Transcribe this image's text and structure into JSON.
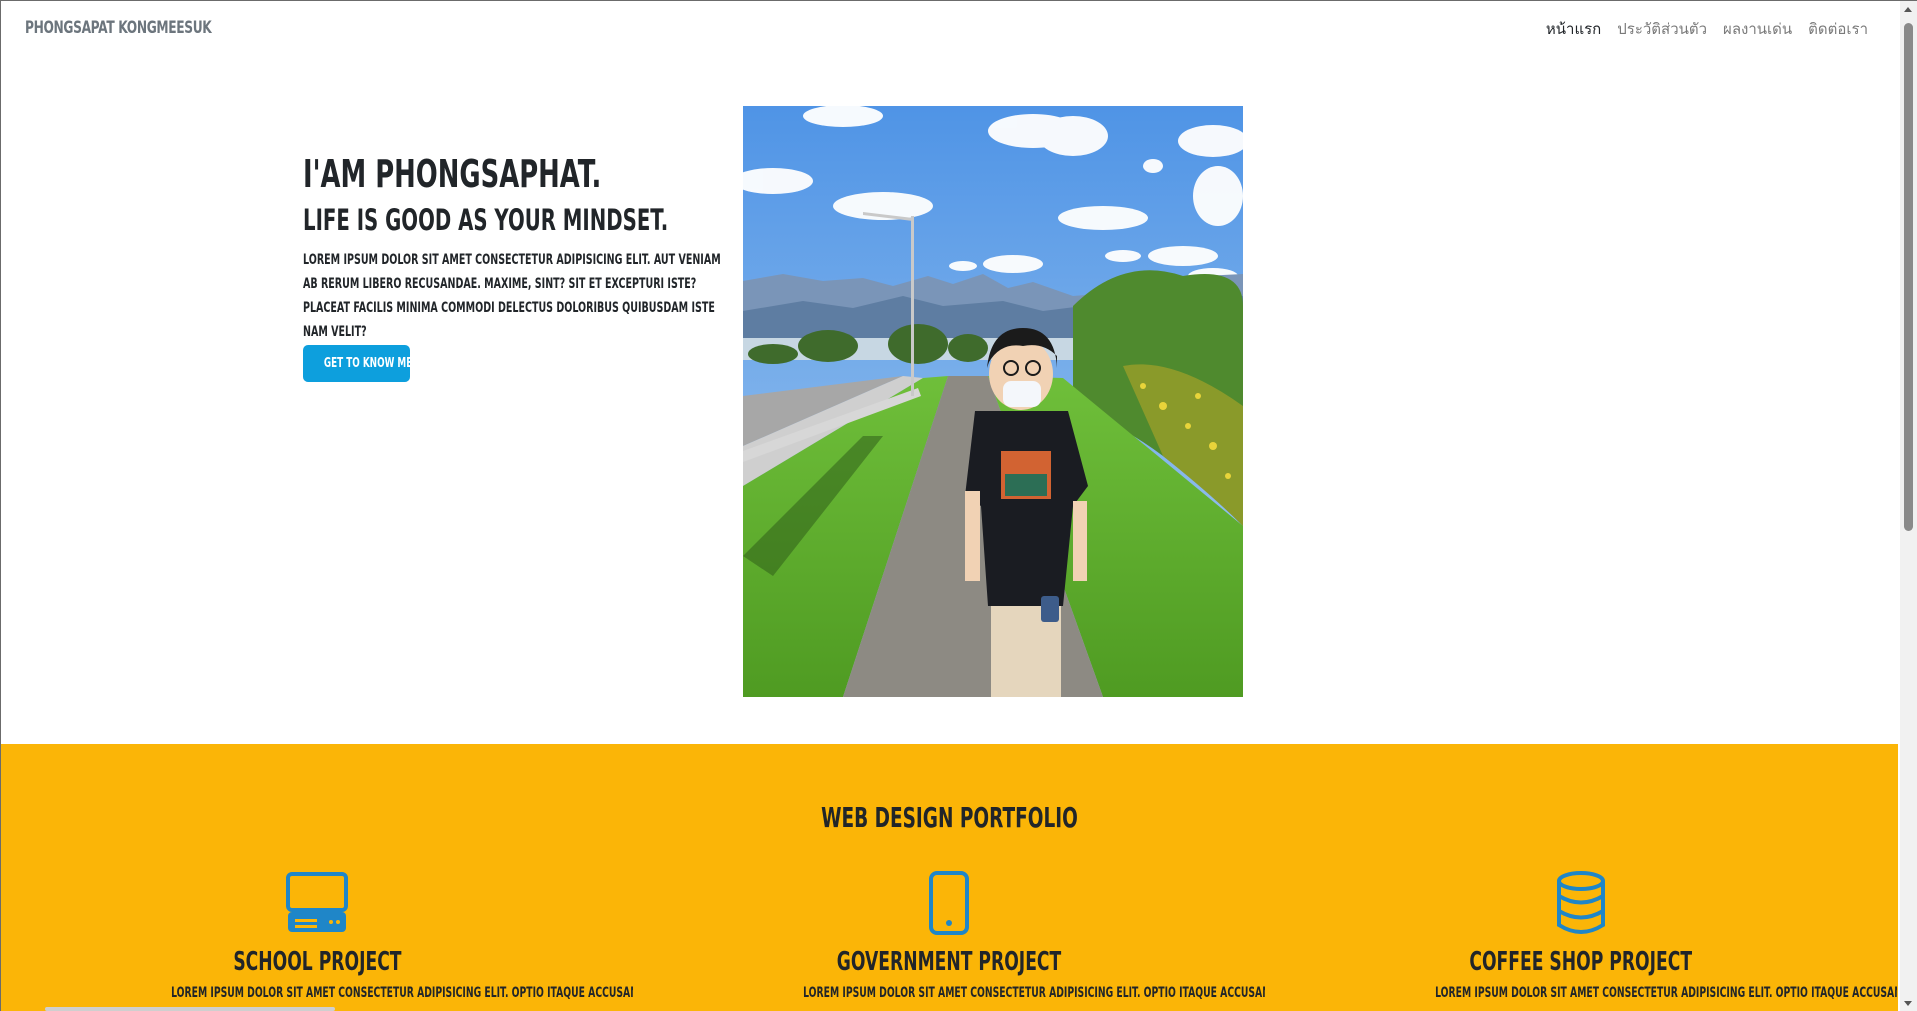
{
  "navbar": {
    "brand": "PHONGSAPAT KONGMEESUK",
    "links": [
      {
        "label": "หน้าแรก",
        "active": true
      },
      {
        "label": "ประวัติส่วนตัว",
        "active": false
      },
      {
        "label": "ผลงานเด่น",
        "active": false
      },
      {
        "label": "ติดต่อเรา",
        "active": false
      }
    ]
  },
  "hero": {
    "title": "I'AM PHONGSAPHAT.",
    "subtitle": "LIFE IS GOOD AS YOUR MINDSET.",
    "body": "LOREM IPSUM DOLOR SIT AMET CONSECTETUR ADIPISICING ELIT. AUT VENIAM AB RERUM LIBERO RECUSANDAE. MAXIME, SINT? SIT ET EXCEPTURI ISTE? PLACEAT FACILIS MINIMA COMMODI DELECTUS DOLORIBUS QUIBUSDAM ISTE NAM VELIT?",
    "button_label": "GET TO KNOW ME"
  },
  "portfolio": {
    "title": "WEB DESIGN PORTFOLIO",
    "cards": [
      {
        "icon": "computer-icon",
        "title": "SCHOOL PROJECT",
        "body": "LOREM IPSUM DOLOR SIT AMET CONSECTETUR ADIPISICING ELIT. OPTIO ITAQUE ACCUSANTIUM FUGA. MAIORES VOLUPTATIBUS"
      },
      {
        "icon": "phone-icon",
        "title": "GOVERNMENT PROJECT",
        "body": "LOREM IPSUM DOLOR SIT AMET CONSECTETUR ADIPISICING ELIT. OPTIO ITAQUE ACCUSANTIUM FUGA. MAIORES VOLUPTATIBUS"
      },
      {
        "icon": "database-icon",
        "title": "COFFEE SHOP PROJECT",
        "body": "LOREM IPSUM DOLOR SIT AMET CONSECTETUR ADIPISICING ELIT. OPTIO ITAQUE ACCUSANTIUM FUGA. MAIORES VOLUPTATIBUS"
      }
    ]
  },
  "colors": {
    "accent": "#0d9fdd",
    "portfolio_bg": "#fbb507",
    "icon": "#1f86c8",
    "text": "#212529",
    "muted": "#6c757d"
  }
}
